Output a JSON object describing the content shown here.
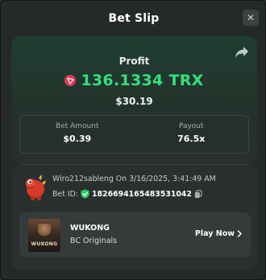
{
  "header": {
    "title": "Bet Slip",
    "close_label": "✕"
  },
  "profit": {
    "label": "Profit",
    "value": "136.1334 TRX",
    "usd": "$30.19"
  },
  "stats": {
    "bet_amount_label": "Bet Amount",
    "bet_amount_value": "$0.39",
    "payout_label": "Payout",
    "payout_value": "76.5x"
  },
  "bet_info": {
    "user_line": "Wiro212sableng On 3/16/2025, 3:41:49 AM",
    "bet_id_label": "Bet ID:",
    "bet_id_value": "1826694165483531042"
  },
  "game": {
    "thumb_text": "WUKONG",
    "title": "WUKONG",
    "subtitle": "BC Originals",
    "play_label": "Play Now"
  },
  "colors": {
    "profit_green": "#33e17d",
    "trx_red": "#e03a5a",
    "shield_green": "#2fcf6a"
  }
}
